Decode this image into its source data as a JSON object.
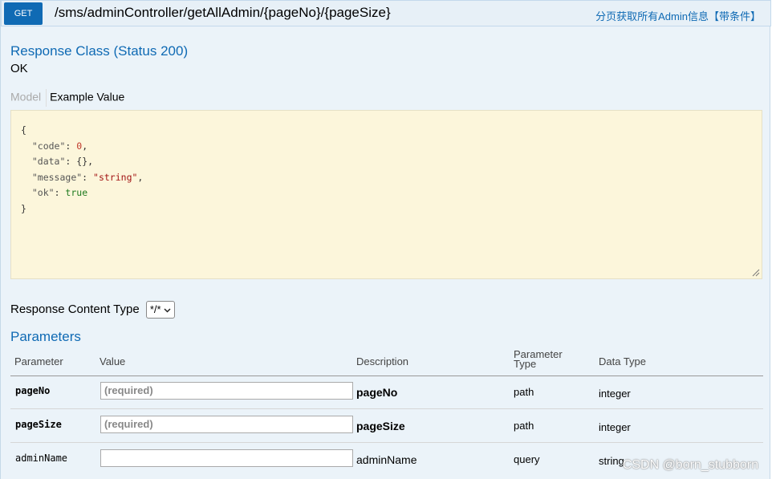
{
  "endpoint": {
    "method": "GET",
    "path": "/sms/adminController/getAllAdmin/{pageNo}/{pageSize}",
    "summary": "分页获取所有Admin信息【带条件】"
  },
  "response_class": {
    "title": "Response Class (Status 200)",
    "status_text": "OK",
    "tabs": {
      "model": "Model",
      "example": "Example Value"
    },
    "example_lines": {
      "open": "{",
      "code_key": "\"code\"",
      "code_val": "0",
      "data_key": "\"data\"",
      "data_val": "{}",
      "message_key": "\"message\"",
      "message_val": "\"string\"",
      "ok_key": "\"ok\"",
      "ok_val": "true",
      "close": "}"
    }
  },
  "content_type": {
    "label": "Response Content Type",
    "selected": "*/*"
  },
  "parameters": {
    "title": "Parameters",
    "headers": {
      "parameter": "Parameter",
      "value": "Value",
      "description": "Description",
      "parameter_type_1": "Parameter",
      "parameter_type_2": "Type",
      "data_type": "Data Type"
    },
    "rows": [
      {
        "name": "pageNo",
        "placeholder": "(required)",
        "description": "pageNo",
        "param_type": "path",
        "data_type": "integer"
      },
      {
        "name": "pageSize",
        "placeholder": "(required)",
        "description": "pageSize",
        "param_type": "path",
        "data_type": "integer"
      },
      {
        "name": "adminName",
        "placeholder": "",
        "description": "adminName",
        "param_type": "query",
        "data_type": "string"
      }
    ]
  },
  "watermark": "CSDN @born_stubborn"
}
